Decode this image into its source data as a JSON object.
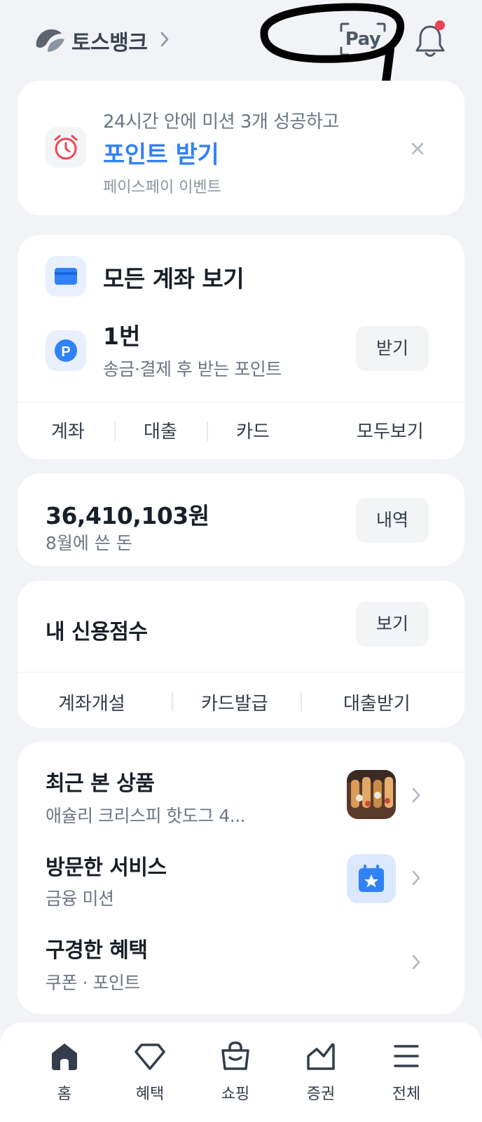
{
  "header": {
    "brand": "토스뱅크",
    "pay_label": "Pay"
  },
  "mission": {
    "subtitle": "24시간 안에 미션 3개 성공하고",
    "title": "포인트 받기",
    "note": "페이스페이 이벤트"
  },
  "accounts": {
    "title": "모든 계좌 보기",
    "points_value": "1번",
    "points_sub": "송금·결제 후 받는 포인트",
    "receive_label": "받기",
    "menu": [
      "계좌",
      "대출",
      "카드",
      "모두보기"
    ]
  },
  "spending": {
    "amount": "36,410,103원",
    "label": "8월에 쓴 돈",
    "history_label": "내역"
  },
  "credit": {
    "title": "내 신용점수",
    "view_label": "보기",
    "menu": [
      "계좌개설",
      "카드발급",
      "대출받기"
    ]
  },
  "recent": {
    "items": [
      {
        "title": "최근 본 상품",
        "subtitle": "애슐리 크리스피 핫도그 4..."
      },
      {
        "title": "방문한 서비스",
        "subtitle": "금융 미션"
      },
      {
        "title": "구경한 혜택",
        "subtitle": "쿠폰 · 포인트"
      }
    ]
  },
  "tabbar": {
    "tabs": [
      {
        "label": "홈",
        "icon": "home-icon"
      },
      {
        "label": "혜택",
        "icon": "diamond-icon"
      },
      {
        "label": "쇼핑",
        "icon": "shopping-bag-icon"
      },
      {
        "label": "증권",
        "icon": "chart-icon"
      },
      {
        "label": "전체",
        "icon": "menu-icon"
      }
    ]
  },
  "colors": {
    "accent": "#3182f6",
    "background": "#f2f3f6",
    "notification_dot": "#f04452"
  }
}
